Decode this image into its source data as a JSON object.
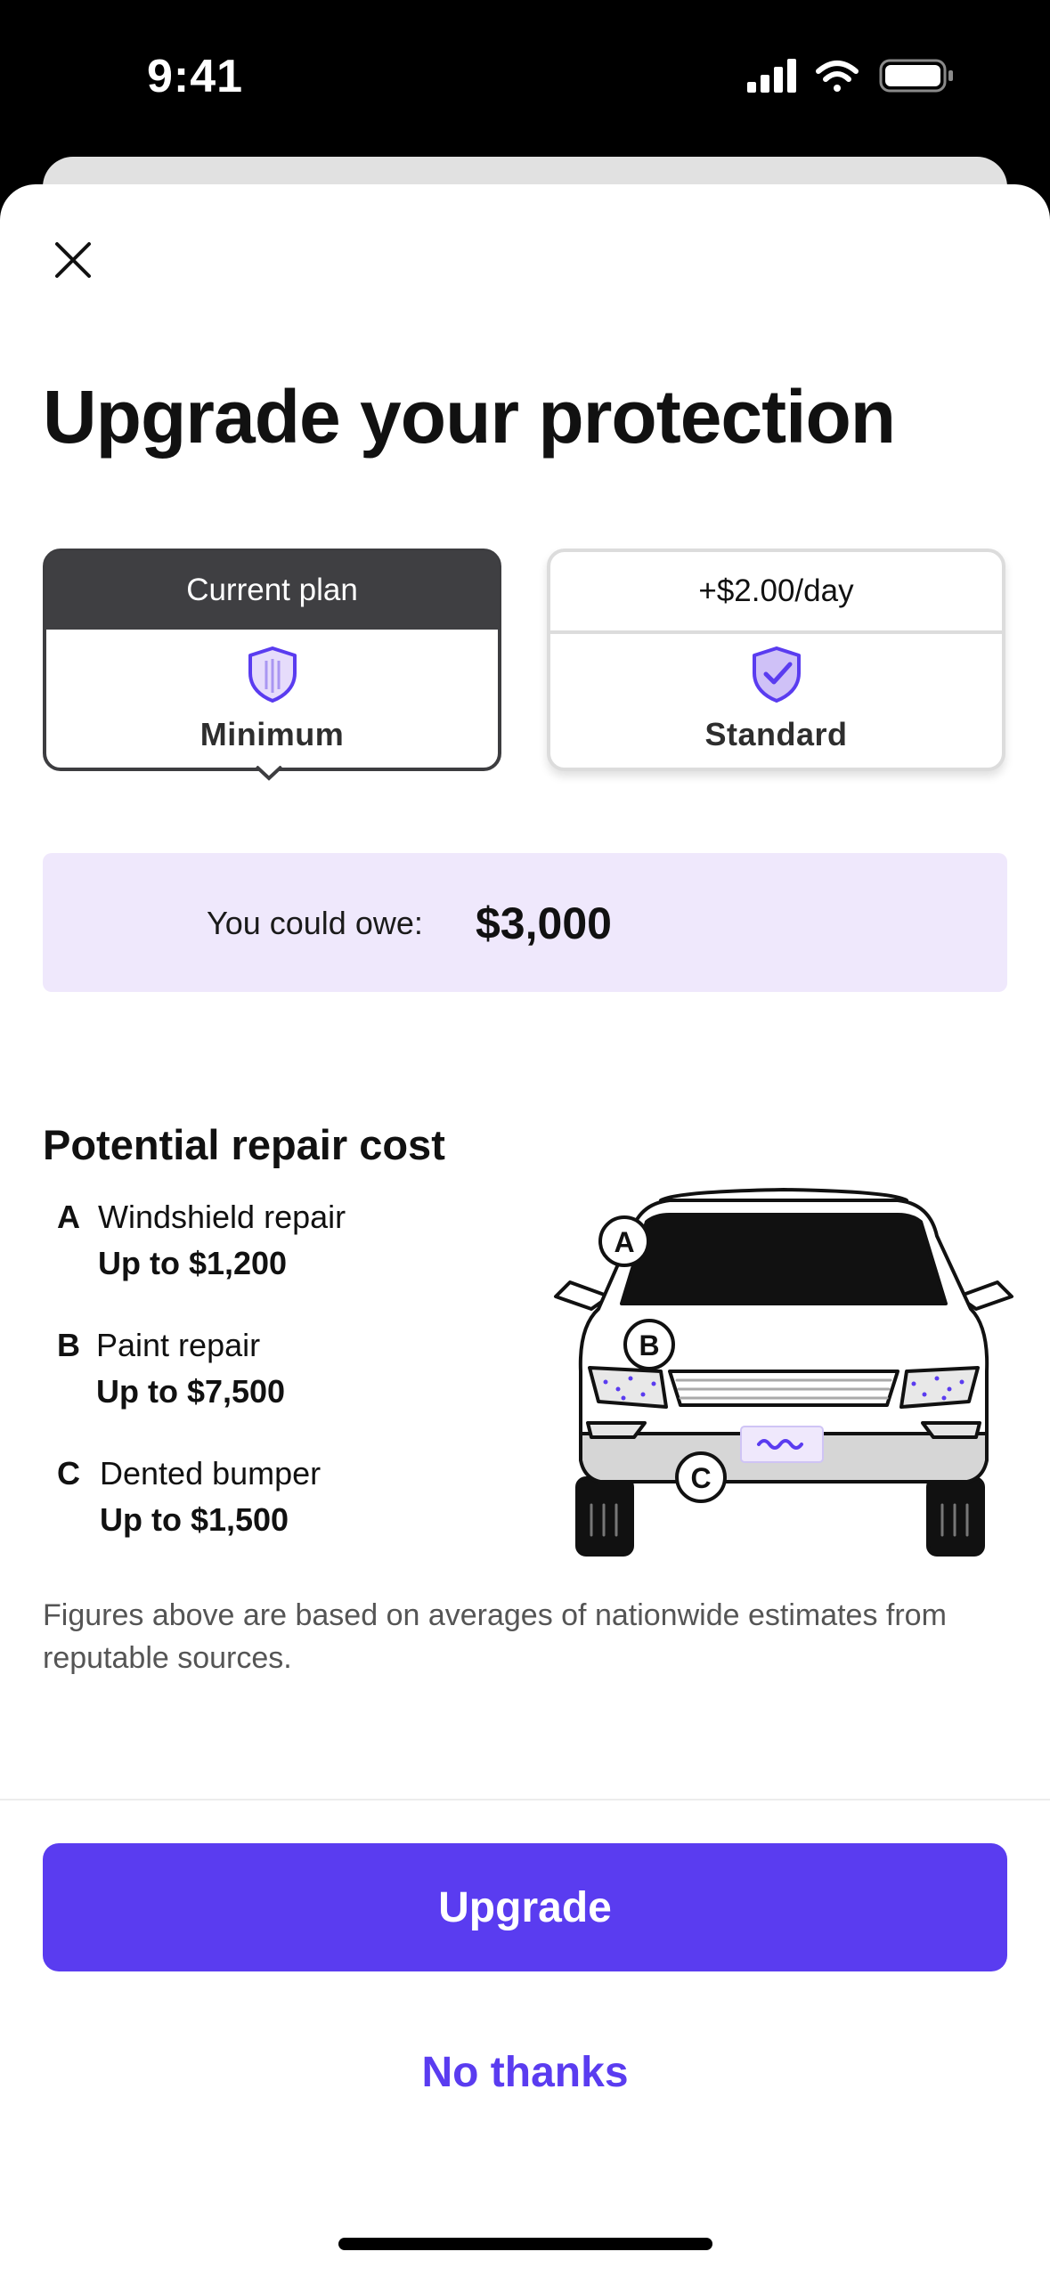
{
  "status_bar": {
    "time": "9:41"
  },
  "header": {
    "title": "Upgrade your protection"
  },
  "plans": {
    "current": {
      "label": "Current plan",
      "name": "Minimum",
      "icon": "shield-icon"
    },
    "alternative": {
      "label": "+$2.00/day",
      "name": "Standard",
      "icon": "shield-check-icon"
    }
  },
  "owe": {
    "label": "You could owe:",
    "amount": "$3,000"
  },
  "repair": {
    "title": "Potential repair cost",
    "items": [
      {
        "letter": "A",
        "name": "Windshield repair",
        "cost": "Up to $1,200"
      },
      {
        "letter": "B",
        "name": "Paint repair",
        "cost": "Up to $7,500"
      },
      {
        "letter": "C",
        "name": "Dented bumper",
        "cost": "Up to $1,500"
      }
    ],
    "diagram_markers": [
      "A",
      "B",
      "C"
    ]
  },
  "disclaimer": "Figures above are based on averages of nationwide estimates from reputable sources.",
  "actions": {
    "upgrade": "Upgrade",
    "decline": "No thanks"
  },
  "colors": {
    "accent": "#5a3cf0",
    "highlight_bg": "#efe8fc",
    "current_plan_header": "#3f3f42"
  }
}
